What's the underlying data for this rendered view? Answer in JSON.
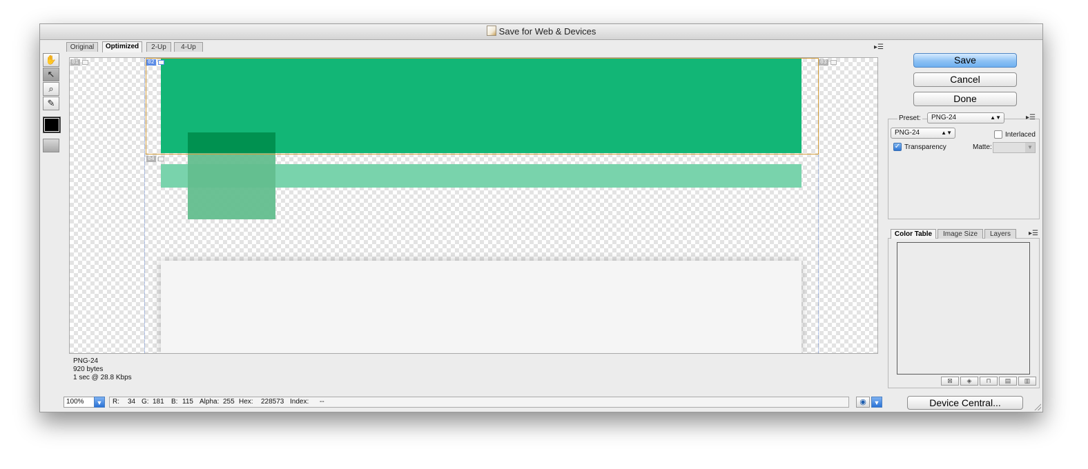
{
  "window": {
    "title": "Save for Web & Devices"
  },
  "view_tabs": [
    "Original",
    "Optimized",
    "2-Up",
    "4-Up"
  ],
  "slices": {
    "labels": [
      "01",
      "02",
      "03",
      "04"
    ],
    "selected": "02"
  },
  "artwork": {
    "banner_color": "#12b676",
    "overlay_color": "#009150",
    "bar_color": "#79d3ac",
    "square_color": "#63be8e",
    "lower_panel_color": "#f5f5f5"
  },
  "info": {
    "format": "PNG-24",
    "size": "920 bytes",
    "download": "1 sec @ 28.8 Kbps"
  },
  "status": {
    "zoom": "100%",
    "r_label": "R:",
    "r": "34",
    "g_label": "G:",
    "g": "181",
    "b_label": "B:",
    "b": "115",
    "alpha_label": "Alpha:",
    "alpha": "255",
    "hex_label": "Hex:",
    "hex": "228573",
    "index_label": "Index:",
    "index": "--"
  },
  "buttons": {
    "save": "Save",
    "cancel": "Cancel",
    "done": "Done",
    "device_central": "Device Central..."
  },
  "settings": {
    "preset_label": "Preset:",
    "preset_value": "PNG-24",
    "format_value": "PNG-24",
    "interlaced_label": "Interlaced",
    "interlaced": false,
    "transparency_label": "Transparency",
    "transparency": true,
    "matte_label": "Matte:"
  },
  "lower_tabs": [
    "Color Table",
    "Image Size",
    "Layers"
  ],
  "colors": {
    "accent": "#2c74d4",
    "slice_selected": "#d39d3b",
    "slice_badge_selected": "#5a8be6"
  }
}
